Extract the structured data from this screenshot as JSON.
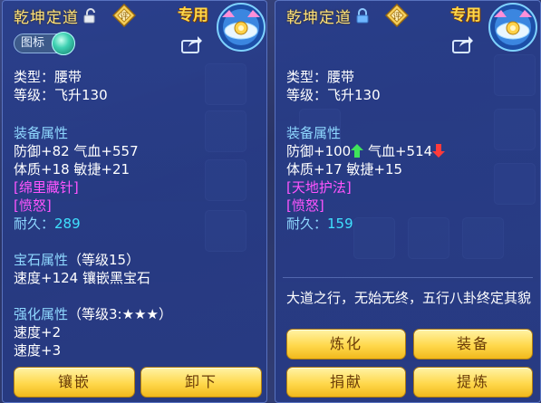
{
  "left_panel": {
    "item_name": "乾坤定道",
    "special_tag": "专用",
    "tag_button_label": "图标",
    "type_line": "类型：腰带",
    "level_line": "等级：飞升130",
    "equip_section": "装备属性",
    "stats_line1": "防御+82 气血+557",
    "stats_line2": "体质+18 敏捷+21",
    "special_skill": "[绵里藏针]",
    "special_effect": "[愤怒]",
    "durability_label": "耐久：",
    "durability_value": "289",
    "gem_section_title": "宝石属性",
    "gem_section_level": "（等级15）",
    "gem_line": "速度+124 镶嵌黑宝石",
    "enhance_section_title": "强化属性",
    "enhance_section_level": "（等级3:★★★）",
    "enhance_line1": "速度+2",
    "enhance_line2": "速度+3",
    "buttons": [
      "镶嵌",
      "卸下"
    ]
  },
  "right_panel": {
    "item_name": "乾坤定道",
    "special_tag": "专用",
    "type_line": "类型：腰带",
    "level_line": "等级：飞升130",
    "equip_section": "装备属性",
    "stat_defense": "防御+100",
    "stat_hp": "气血+514",
    "stats_line2": "体质+17 敏捷+15",
    "special_skill": "[天地护法]",
    "special_effect": "[愤怒]",
    "durability_label": "耐久：",
    "durability_value": "159",
    "description": "大道之行，无始无终，五行八卦终定其貌",
    "buttons": [
      "炼化",
      "装备",
      "捐献",
      "提炼"
    ]
  },
  "icons": {
    "lock_left": "unlocked-padlock-icon",
    "lock_right": "locked-padlock-icon",
    "badge": "appraisal-badge-icon",
    "item": "belt-item-icon",
    "share": "share-icon",
    "orb": "jade-orb-icon",
    "arrow_up": "green-up-arrow-icon",
    "arrow_down": "red-down-arrow-icon"
  },
  "colors": {
    "item_name": "#ffe27a",
    "section_title": "#8fd8ff",
    "special_skill": "#ff55ff",
    "durability_value": "#3fe1ff",
    "button_fill": "#ffd84c",
    "stat_up": "#3fe35a",
    "stat_down": "#ff3b3b"
  }
}
